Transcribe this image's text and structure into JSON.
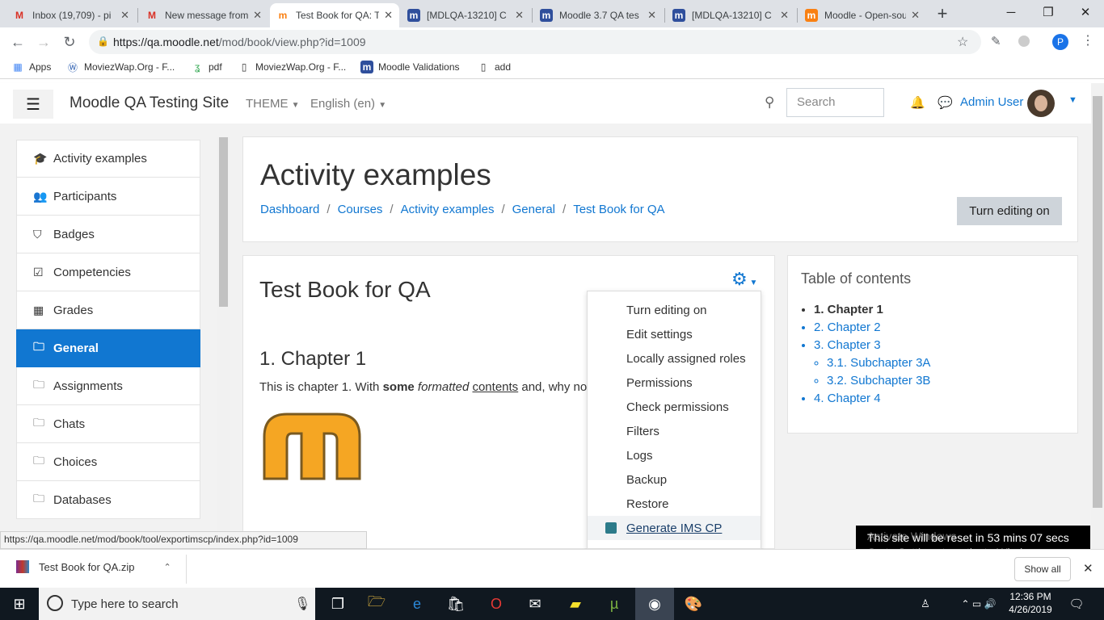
{
  "browser": {
    "tabs": [
      {
        "label": "Inbox (19,709) - pi",
        "icon": "gmail-icon"
      },
      {
        "label": "New message from",
        "icon": "gmail-icon"
      },
      {
        "label": "Test Book for QA: T",
        "icon": "moodle-icon",
        "active": true
      },
      {
        "label": "[MDLQA-13210] C",
        "icon": "jira-icon"
      },
      {
        "label": "Moodle 3.7 QA tes",
        "icon": "jira-icon"
      },
      {
        "label": "[MDLQA-13210] C",
        "icon": "jira-icon"
      },
      {
        "label": "Moodle - Open-sou",
        "icon": "moodle-icon"
      }
    ],
    "url_host": "https://qa.moodle.net",
    "url_path": "/mod/book/view.php?id=1009",
    "profile_initial": "P",
    "bookmarks": [
      {
        "label": "Apps",
        "icon": "apps-grid-icon"
      },
      {
        "label": "MoviezWap.Org - F...",
        "icon": "site-icon"
      },
      {
        "label": "pdf",
        "icon": "leaf-icon"
      },
      {
        "label": "MoviezWap.Org - F...",
        "icon": "page-icon"
      },
      {
        "label": "Moodle Validations",
        "icon": "jira-icon"
      },
      {
        "label": "add",
        "icon": "page-icon"
      }
    ]
  },
  "navbar": {
    "site_name": "Moodle QA Testing Site",
    "theme_label": "THEME",
    "language_label": "English (en)",
    "search_placeholder": "Search",
    "user_name": "Admin User"
  },
  "drawer": {
    "items": [
      {
        "label": "Activity examples",
        "icon": "graduation-cap-icon"
      },
      {
        "label": "Participants",
        "icon": "users-icon"
      },
      {
        "label": "Badges",
        "icon": "shield-icon"
      },
      {
        "label": "Competencies",
        "icon": "checkbox-icon"
      },
      {
        "label": "Grades",
        "icon": "table-icon"
      },
      {
        "label": "General",
        "icon": "folder-icon",
        "active": true
      },
      {
        "label": "Assignments",
        "icon": "folder-icon"
      },
      {
        "label": "Chats",
        "icon": "folder-icon"
      },
      {
        "label": "Choices",
        "icon": "folder-icon"
      },
      {
        "label": "Databases",
        "icon": "folder-icon"
      }
    ]
  },
  "header": {
    "title": "Activity examples",
    "breadcrumbs": [
      "Dashboard",
      "Courses",
      "Activity examples",
      "General",
      "Test Book for QA"
    ],
    "edit_button": "Turn editing on"
  },
  "book": {
    "title": "Test Book for QA",
    "chapter_title": "1. Chapter 1",
    "text_pre": "This is chapter 1. With ",
    "text_bold": "some",
    "text_italic": "formatted",
    "text_under": "contents",
    "text_post": " and, why not"
  },
  "actions_menu": {
    "items": [
      "Turn editing on",
      "Edit settings",
      "Locally assigned roles",
      "Permissions",
      "Check permissions",
      "Filters",
      "Logs",
      "Backup",
      "Restore",
      "Generate IMS CP"
    ],
    "hovered_index": 9
  },
  "toc": {
    "heading": "Table of contents",
    "items": [
      "1. Chapter 1",
      "2. Chapter 2",
      "3. Chapter 3",
      "3.1. Subchapter 3A",
      "3.2. Subchapter 3B",
      "4. Chapter 4"
    ]
  },
  "status_url": "https://qa.moodle.net/mod/book/tool/exportimscp/index.php?id=1009",
  "reset_notice": "This site will be reset in 53 mins 07 secs",
  "watermark": {
    "line1": "Activate Windows",
    "line2": "Go to Settings to activate Windows."
  },
  "downloads": {
    "file": "Test Book for QA.zip",
    "show_all": "Show all"
  },
  "taskbar": {
    "search_placeholder": "Type here to search",
    "time": "12:36 PM",
    "date": "4/26/2019"
  },
  "colors": {
    "accent": "#1177d1",
    "drawer_active": "#1177d1",
    "page_bg": "#f2f2f2"
  }
}
